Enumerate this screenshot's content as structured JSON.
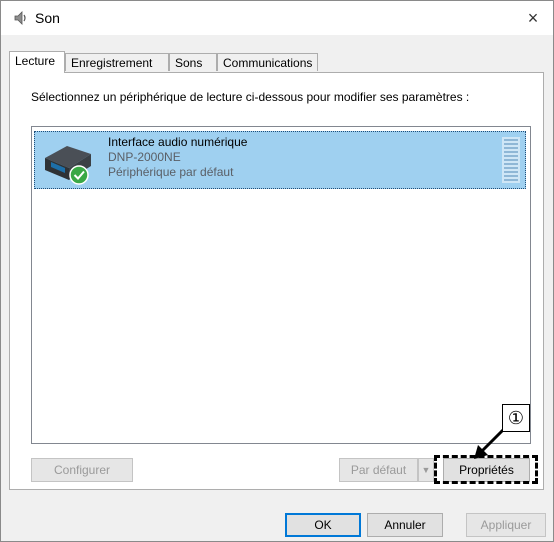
{
  "window": {
    "title": "Son",
    "close_label": "×"
  },
  "tabs": [
    {
      "label": "Lecture",
      "active": true
    },
    {
      "label": "Enregistrement",
      "active": false
    },
    {
      "label": "Sons",
      "active": false
    },
    {
      "label": "Communications",
      "active": false
    }
  ],
  "panel": {
    "instruction": "Sélectionnez un périphérique de lecture ci-dessous pour modifier ses paramètres :",
    "devices": [
      {
        "name": "Interface audio numérique",
        "model": "DNP-2000NE",
        "status": "Périphérique par défaut",
        "icon": "usb-audio-device-icon",
        "badge": "default-check-icon",
        "selected": true
      }
    ],
    "buttons": {
      "configure": "Configurer",
      "set_default": "Par défaut",
      "set_default_arrow": "▼",
      "properties": "Propriétés"
    }
  },
  "footer": {
    "ok": "OK",
    "cancel": "Annuler",
    "apply": "Appliquer"
  },
  "callout": {
    "label": "①"
  },
  "colors": {
    "selection": "#9fd0f0",
    "check_green": "#3aa845",
    "focus_blue": "#0078d7"
  }
}
